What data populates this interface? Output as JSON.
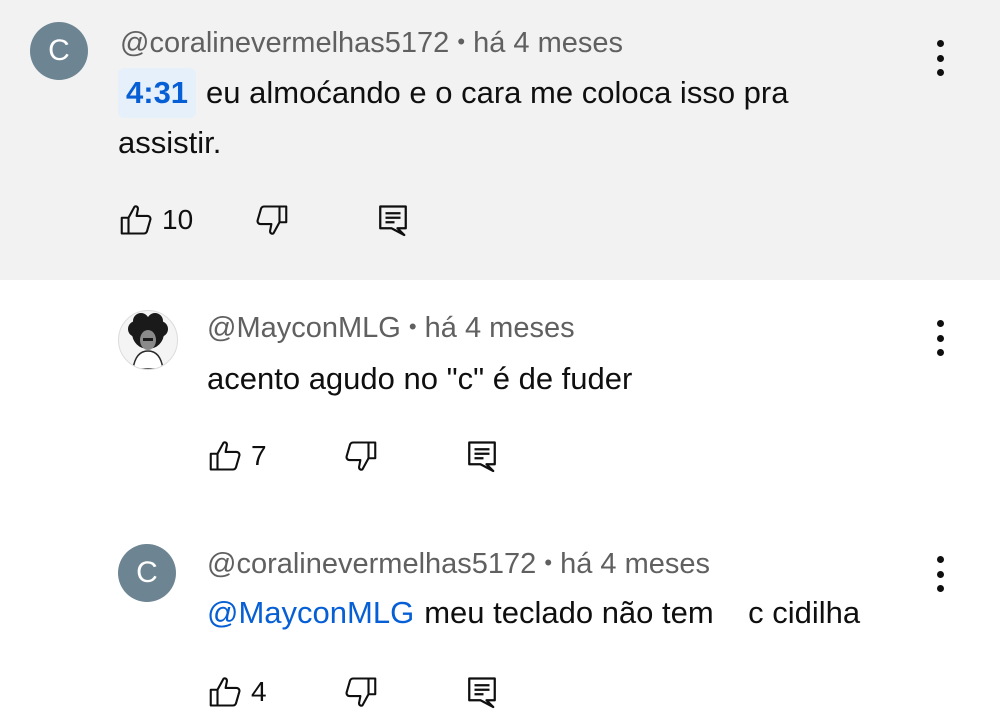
{
  "comments": [
    {
      "author": "@coralinevermelhas5172",
      "sep": "•",
      "time": "há 4 meses",
      "avatar_letter": "C",
      "timestamp": "4:31",
      "text": "eu almoćando e o cara me coloca isso pra assistir.",
      "likes": "10"
    },
    {
      "author": "@MayconMLG",
      "sep": "•",
      "time": "há 4 meses",
      "text": "acento agudo no \"c\" é de fuder",
      "likes": "7"
    },
    {
      "author": "@coralinevermelhas5172",
      "sep": "•",
      "time": "há 4 meses",
      "avatar_letter": "C",
      "mention": "@MayconMLG",
      "text": "meu teclado não tem    c cidilha",
      "likes": "4"
    }
  ],
  "icons": {
    "like": "thumbs-up-icon",
    "dislike": "thumbs-down-icon",
    "reply": "reply-icon",
    "menu": "more-vert-icon"
  },
  "colors": {
    "highlight_bg": "#f2f2f2",
    "link": "#065fd4",
    "avatar_grey": "#6d8593"
  }
}
